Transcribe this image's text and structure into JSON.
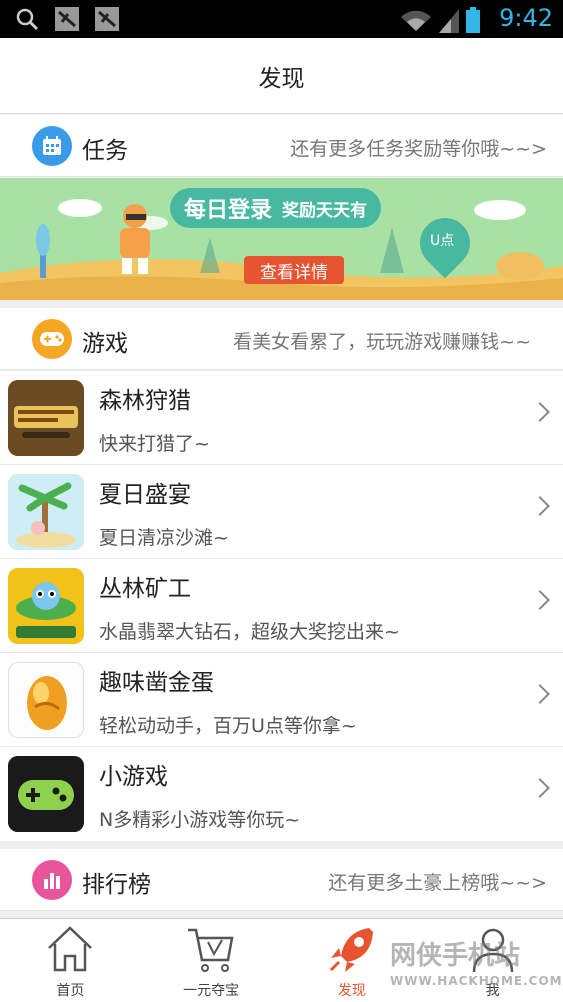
{
  "status_bar": {
    "time": "9:42",
    "icons": [
      "search-icon",
      "notification-icon",
      "notification-icon",
      "wifi-icon",
      "signal-icon",
      "battery-icon"
    ]
  },
  "header": {
    "title": "发现"
  },
  "tasks": {
    "title": "任务",
    "hint": "还有更多任务奖励等你哦~~>",
    "icon_color": "#3a9be8",
    "banner": {
      "title": "每日登录",
      "subtitle": "奖励天天有",
      "cta": "查看详情",
      "pin_label": "U点"
    }
  },
  "games": {
    "title": "游戏",
    "hint": "看美女看累了，玩玩游戏赚赚钱~~",
    "icon_color": "#f5a623",
    "items": [
      {
        "name": "森林狩猎",
        "desc": "快来打猎了~",
        "icon": "forest-hunt-icon"
      },
      {
        "name": "夏日盛宴",
        "desc": "夏日清凉沙滩~",
        "icon": "summer-feast-icon"
      },
      {
        "name": "丛林矿工",
        "desc": "水晶翡翠大钻石，超级大奖挖出来~",
        "icon": "jungle-miner-icon"
      },
      {
        "name": "趣味凿金蛋",
        "desc": "轻松动动手，百万U点等你拿~",
        "icon": "golden-egg-icon"
      },
      {
        "name": "小游戏",
        "desc": "N多精彩小游戏等你玩~",
        "icon": "gamepad-icon"
      }
    ]
  },
  "ranking": {
    "title": "排行榜",
    "hint": "还有更多土豪上榜哦~~>",
    "icon_color": "#e8559a"
  },
  "tabbar": {
    "tabs": [
      {
        "label": "首页",
        "icon": "home-icon"
      },
      {
        "label": "一元夺宝",
        "icon": "cart-icon"
      },
      {
        "label": "发现",
        "icon": "rocket-icon",
        "active": true
      },
      {
        "label": "我",
        "icon": "user-icon"
      }
    ],
    "active_color": "#e8542f"
  },
  "watermark": {
    "text": "网侠手机站",
    "url": "WWW.HACKHOME.COM"
  }
}
